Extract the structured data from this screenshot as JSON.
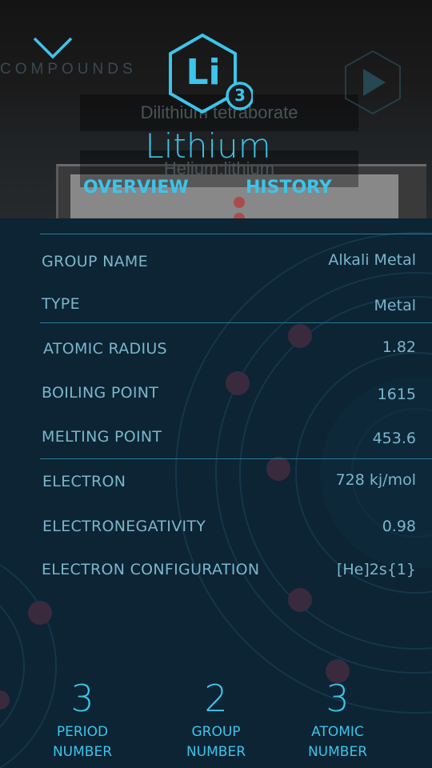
{
  "header": {
    "back_section_label": "COMPOUNDS",
    "background_compounds": [
      "Dilithium tetraborate",
      "Helium;lithium"
    ],
    "element": {
      "symbol": "Li",
      "atomic_number": "3",
      "name": "Lithium"
    },
    "tabs": [
      {
        "label": "OVERVIEW"
      },
      {
        "label": "HISTORY"
      }
    ]
  },
  "properties": [
    {
      "label": "GROUP NAME",
      "value": "Alkali Metal"
    },
    {
      "label": "TYPE",
      "value": "Metal"
    },
    {
      "label": "ATOMIC RADIUS",
      "value": "1.82"
    },
    {
      "label": "BOILING POINT",
      "value": "1615"
    },
    {
      "label": "MELTING POINT",
      "value": "453.6"
    },
    {
      "label": "ELECTRON",
      "value": "728 kj/mol"
    },
    {
      "label": "ELECTRONEGATIVITY",
      "value": "0.98"
    },
    {
      "label": "ELECTRON CONFIGURATION",
      "value": "[He]2s{1}"
    }
  ],
  "stats": [
    {
      "value": "3",
      "caption_line1": "PERIOD",
      "caption_line2": "NUMBER"
    },
    {
      "value": "2",
      "caption_line1": "GROUP",
      "caption_line2": "NUMBER"
    },
    {
      "value": "3",
      "caption_line1": "ATOMIC",
      "caption_line2": "NUMBER"
    }
  ],
  "colors": {
    "accent": "#3dc4ea",
    "panel_background": "#0c2434",
    "label_text": "#7ab6cb",
    "orbit_dot": "#5a2a3a"
  },
  "icons": {
    "collapse": "chevron-down-icon",
    "element_badge": "hexagon-icon",
    "play": "play-icon"
  }
}
